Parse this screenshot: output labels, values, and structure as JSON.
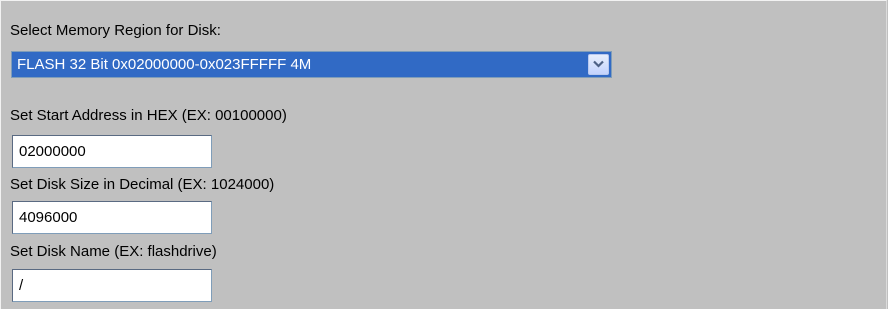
{
  "memory_region": {
    "label": "Select Memory Region for Disk:",
    "selected": "FLASH 32 Bit 0x02000000-0x023FFFFF 4M",
    "arrow_icon": "chevron-down-icon"
  },
  "start_address": {
    "label": "Set Start Address in HEX (EX: 00100000)",
    "value": "02000000"
  },
  "disk_size": {
    "label": "Set Disk Size in Decimal (EX: 1024000)",
    "value": "4096000"
  },
  "disk_name": {
    "label": "Set Disk Name (EX: flashdrive)",
    "value": "/"
  },
  "colors": {
    "background": "#c0c0c0",
    "selection": "#316ac5",
    "field_border": "#7f9db9"
  }
}
